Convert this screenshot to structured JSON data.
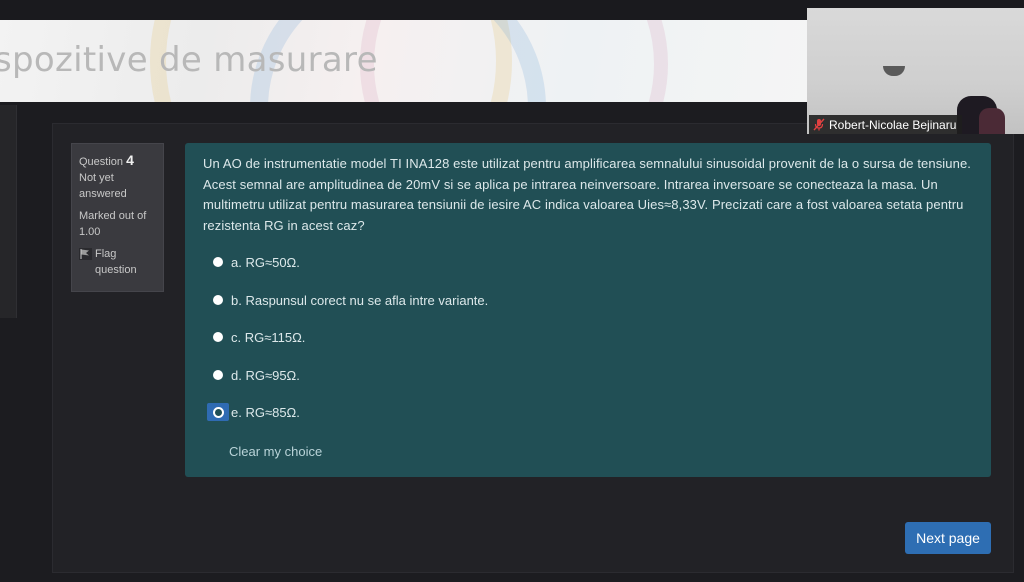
{
  "header": {
    "title": "spozitive de masurare"
  },
  "question_info": {
    "label": "Question",
    "number": "4",
    "status": "Not yet answered",
    "marks": "Marked out of 1.00",
    "flag_label": "Flag question"
  },
  "question": {
    "text": "Un AO de instrumentatie model TI INA128 este utilizat pentru amplificarea semnalului sinusoidal provenit de la o sursa de tensiune. Acest semnal are amplitudinea de 20mV si se aplica pe intrarea neinversoare. Intrarea inversoare se conecteaza la masa. Un multimetru utilizat pentru masurarea tensiunii de iesire AC indica valoarea Uies≈8,33V. Precizati care a fost valoarea setata pentru rezistenta RG in acest caz?",
    "answers": [
      {
        "label": "a. RG≈50Ω.",
        "selected": false
      },
      {
        "label": "b. Raspunsul corect nu se afla intre variante.",
        "selected": false
      },
      {
        "label": "c. RG≈115Ω.",
        "selected": false
      },
      {
        "label": "d. RG≈95Ω.",
        "selected": false
      },
      {
        "label": "e. RG≈85Ω.",
        "selected": true
      }
    ],
    "clear_label": "Clear my choice"
  },
  "navigation": {
    "next_label": "Next page"
  },
  "video": {
    "participant_name": "Robert-Nicolae Bejinaru",
    "mic_muted": true
  },
  "colors": {
    "question_bg": "#214f55",
    "button_bg": "#2e6eb3",
    "page_bg": "#1c1c20"
  }
}
